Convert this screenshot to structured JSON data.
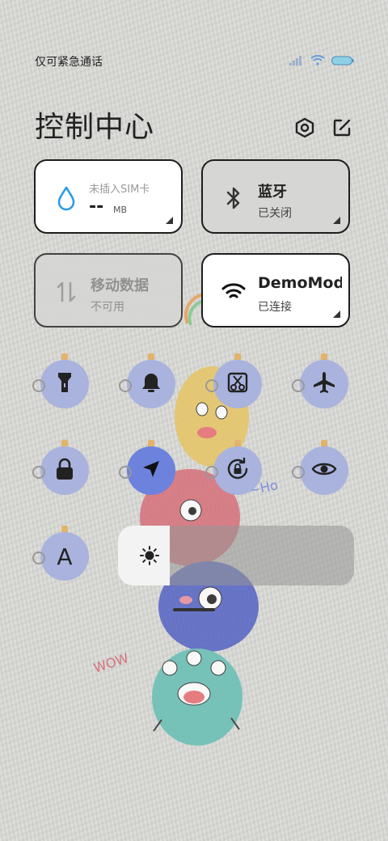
{
  "status": {
    "carrier_text": "仅可紧急通话",
    "icons": [
      "signal-icon",
      "wifi-icon",
      "battery-icon"
    ]
  },
  "header": {
    "title": "控制中心",
    "settings_icon": "settings-hexagon-icon",
    "edit_icon": "edit-icon"
  },
  "tiles": {
    "data_usage": {
      "title": "未插入SIM卡",
      "value": "--",
      "unit": "MB",
      "icon": "water-drop-icon"
    },
    "bluetooth": {
      "title": "蓝牙",
      "subtitle": "已关闭",
      "icon": "bluetooth-icon"
    },
    "mobile_data": {
      "title": "移动数据",
      "subtitle": "不可用",
      "icon": "mobile-data-icon"
    },
    "wifi": {
      "title": "DemoMode",
      "subtitle": "已连接",
      "icon": "wifi-icon"
    }
  },
  "toggles": [
    {
      "name": "flashlight-icon"
    },
    {
      "name": "bell-icon"
    },
    {
      "name": "screenshot-icon"
    },
    {
      "name": "airplane-icon"
    },
    {
      "name": "lock-icon"
    },
    {
      "name": "location-icon",
      "active": true
    },
    {
      "name": "rotation-lock-icon"
    },
    {
      "name": "eye-icon"
    },
    {
      "name": "font-icon",
      "label": "A"
    }
  ],
  "brightness": {
    "level": 0.22,
    "icon": "sun-icon"
  },
  "colors": {
    "toggle_bg": "#a9b3dd",
    "toggle_active_bg": "#6d82dd",
    "wifi_blue": "#2b9de8",
    "tile_on": "#ffffff",
    "tile_off": "#d6d6d4"
  }
}
